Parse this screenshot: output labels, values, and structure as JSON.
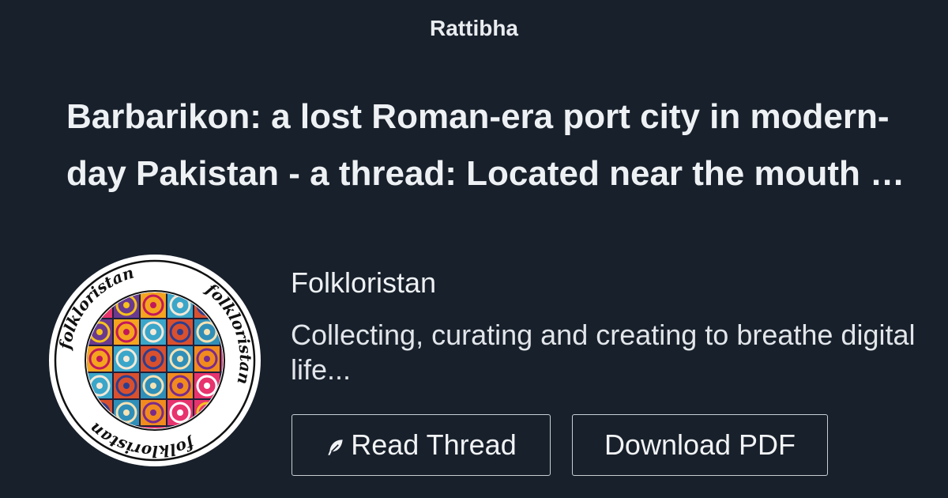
{
  "site": {
    "name": "Rattibha"
  },
  "thread": {
    "title": "Barbarikon: a lost Roman-era port city in modern-day Pakistan - a thread: Located near the mouth of the Indus River"
  },
  "author": {
    "name": "Folkloristan",
    "bio": "Collecting, curating and creating to breathe digital life...",
    "avatar_ring_text": "folkloristan"
  },
  "actions": {
    "read_label": "Read Thread",
    "read_icon": "feather-icon",
    "pdf_label": "Download PDF"
  },
  "colors": {
    "background": "#18202b",
    "text": "#eef1f4",
    "button_border": "#c9ced4"
  }
}
